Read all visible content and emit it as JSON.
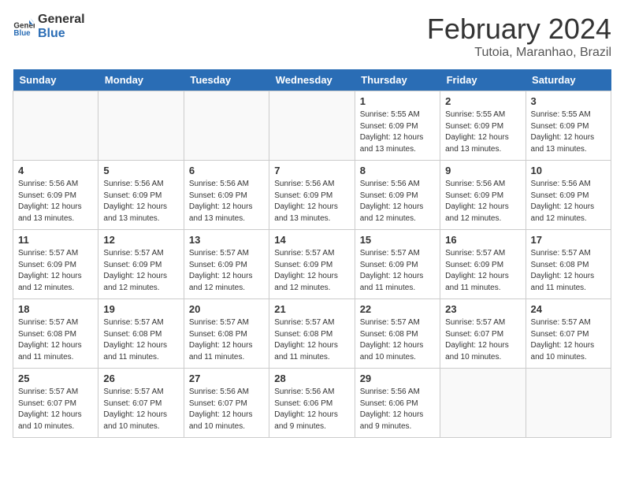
{
  "logo": {
    "line1": "General",
    "line2": "Blue"
  },
  "title": "February 2024",
  "subtitle": "Tutoia, Maranhao, Brazil",
  "headers": [
    "Sunday",
    "Monday",
    "Tuesday",
    "Wednesday",
    "Thursday",
    "Friday",
    "Saturday"
  ],
  "weeks": [
    [
      {
        "day": "",
        "info": ""
      },
      {
        "day": "",
        "info": ""
      },
      {
        "day": "",
        "info": ""
      },
      {
        "day": "",
        "info": ""
      },
      {
        "day": "1",
        "info": "Sunrise: 5:55 AM\nSunset: 6:09 PM\nDaylight: 12 hours\nand 13 minutes."
      },
      {
        "day": "2",
        "info": "Sunrise: 5:55 AM\nSunset: 6:09 PM\nDaylight: 12 hours\nand 13 minutes."
      },
      {
        "day": "3",
        "info": "Sunrise: 5:55 AM\nSunset: 6:09 PM\nDaylight: 12 hours\nand 13 minutes."
      }
    ],
    [
      {
        "day": "4",
        "info": "Sunrise: 5:56 AM\nSunset: 6:09 PM\nDaylight: 12 hours\nand 13 minutes."
      },
      {
        "day": "5",
        "info": "Sunrise: 5:56 AM\nSunset: 6:09 PM\nDaylight: 12 hours\nand 13 minutes."
      },
      {
        "day": "6",
        "info": "Sunrise: 5:56 AM\nSunset: 6:09 PM\nDaylight: 12 hours\nand 13 minutes."
      },
      {
        "day": "7",
        "info": "Sunrise: 5:56 AM\nSunset: 6:09 PM\nDaylight: 12 hours\nand 13 minutes."
      },
      {
        "day": "8",
        "info": "Sunrise: 5:56 AM\nSunset: 6:09 PM\nDaylight: 12 hours\nand 12 minutes."
      },
      {
        "day": "9",
        "info": "Sunrise: 5:56 AM\nSunset: 6:09 PM\nDaylight: 12 hours\nand 12 minutes."
      },
      {
        "day": "10",
        "info": "Sunrise: 5:56 AM\nSunset: 6:09 PM\nDaylight: 12 hours\nand 12 minutes."
      }
    ],
    [
      {
        "day": "11",
        "info": "Sunrise: 5:57 AM\nSunset: 6:09 PM\nDaylight: 12 hours\nand 12 minutes."
      },
      {
        "day": "12",
        "info": "Sunrise: 5:57 AM\nSunset: 6:09 PM\nDaylight: 12 hours\nand 12 minutes."
      },
      {
        "day": "13",
        "info": "Sunrise: 5:57 AM\nSunset: 6:09 PM\nDaylight: 12 hours\nand 12 minutes."
      },
      {
        "day": "14",
        "info": "Sunrise: 5:57 AM\nSunset: 6:09 PM\nDaylight: 12 hours\nand 12 minutes."
      },
      {
        "day": "15",
        "info": "Sunrise: 5:57 AM\nSunset: 6:09 PM\nDaylight: 12 hours\nand 11 minutes."
      },
      {
        "day": "16",
        "info": "Sunrise: 5:57 AM\nSunset: 6:09 PM\nDaylight: 12 hours\nand 11 minutes."
      },
      {
        "day": "17",
        "info": "Sunrise: 5:57 AM\nSunset: 6:08 PM\nDaylight: 12 hours\nand 11 minutes."
      }
    ],
    [
      {
        "day": "18",
        "info": "Sunrise: 5:57 AM\nSunset: 6:08 PM\nDaylight: 12 hours\nand 11 minutes."
      },
      {
        "day": "19",
        "info": "Sunrise: 5:57 AM\nSunset: 6:08 PM\nDaylight: 12 hours\nand 11 minutes."
      },
      {
        "day": "20",
        "info": "Sunrise: 5:57 AM\nSunset: 6:08 PM\nDaylight: 12 hours\nand 11 minutes."
      },
      {
        "day": "21",
        "info": "Sunrise: 5:57 AM\nSunset: 6:08 PM\nDaylight: 12 hours\nand 11 minutes."
      },
      {
        "day": "22",
        "info": "Sunrise: 5:57 AM\nSunset: 6:08 PM\nDaylight: 12 hours\nand 10 minutes."
      },
      {
        "day": "23",
        "info": "Sunrise: 5:57 AM\nSunset: 6:07 PM\nDaylight: 12 hours\nand 10 minutes."
      },
      {
        "day": "24",
        "info": "Sunrise: 5:57 AM\nSunset: 6:07 PM\nDaylight: 12 hours\nand 10 minutes."
      }
    ],
    [
      {
        "day": "25",
        "info": "Sunrise: 5:57 AM\nSunset: 6:07 PM\nDaylight: 12 hours\nand 10 minutes."
      },
      {
        "day": "26",
        "info": "Sunrise: 5:57 AM\nSunset: 6:07 PM\nDaylight: 12 hours\nand 10 minutes."
      },
      {
        "day": "27",
        "info": "Sunrise: 5:56 AM\nSunset: 6:07 PM\nDaylight: 12 hours\nand 10 minutes."
      },
      {
        "day": "28",
        "info": "Sunrise: 5:56 AM\nSunset: 6:06 PM\nDaylight: 12 hours\nand 9 minutes."
      },
      {
        "day": "29",
        "info": "Sunrise: 5:56 AM\nSunset: 6:06 PM\nDaylight: 12 hours\nand 9 minutes."
      },
      {
        "day": "",
        "info": ""
      },
      {
        "day": "",
        "info": ""
      }
    ]
  ]
}
